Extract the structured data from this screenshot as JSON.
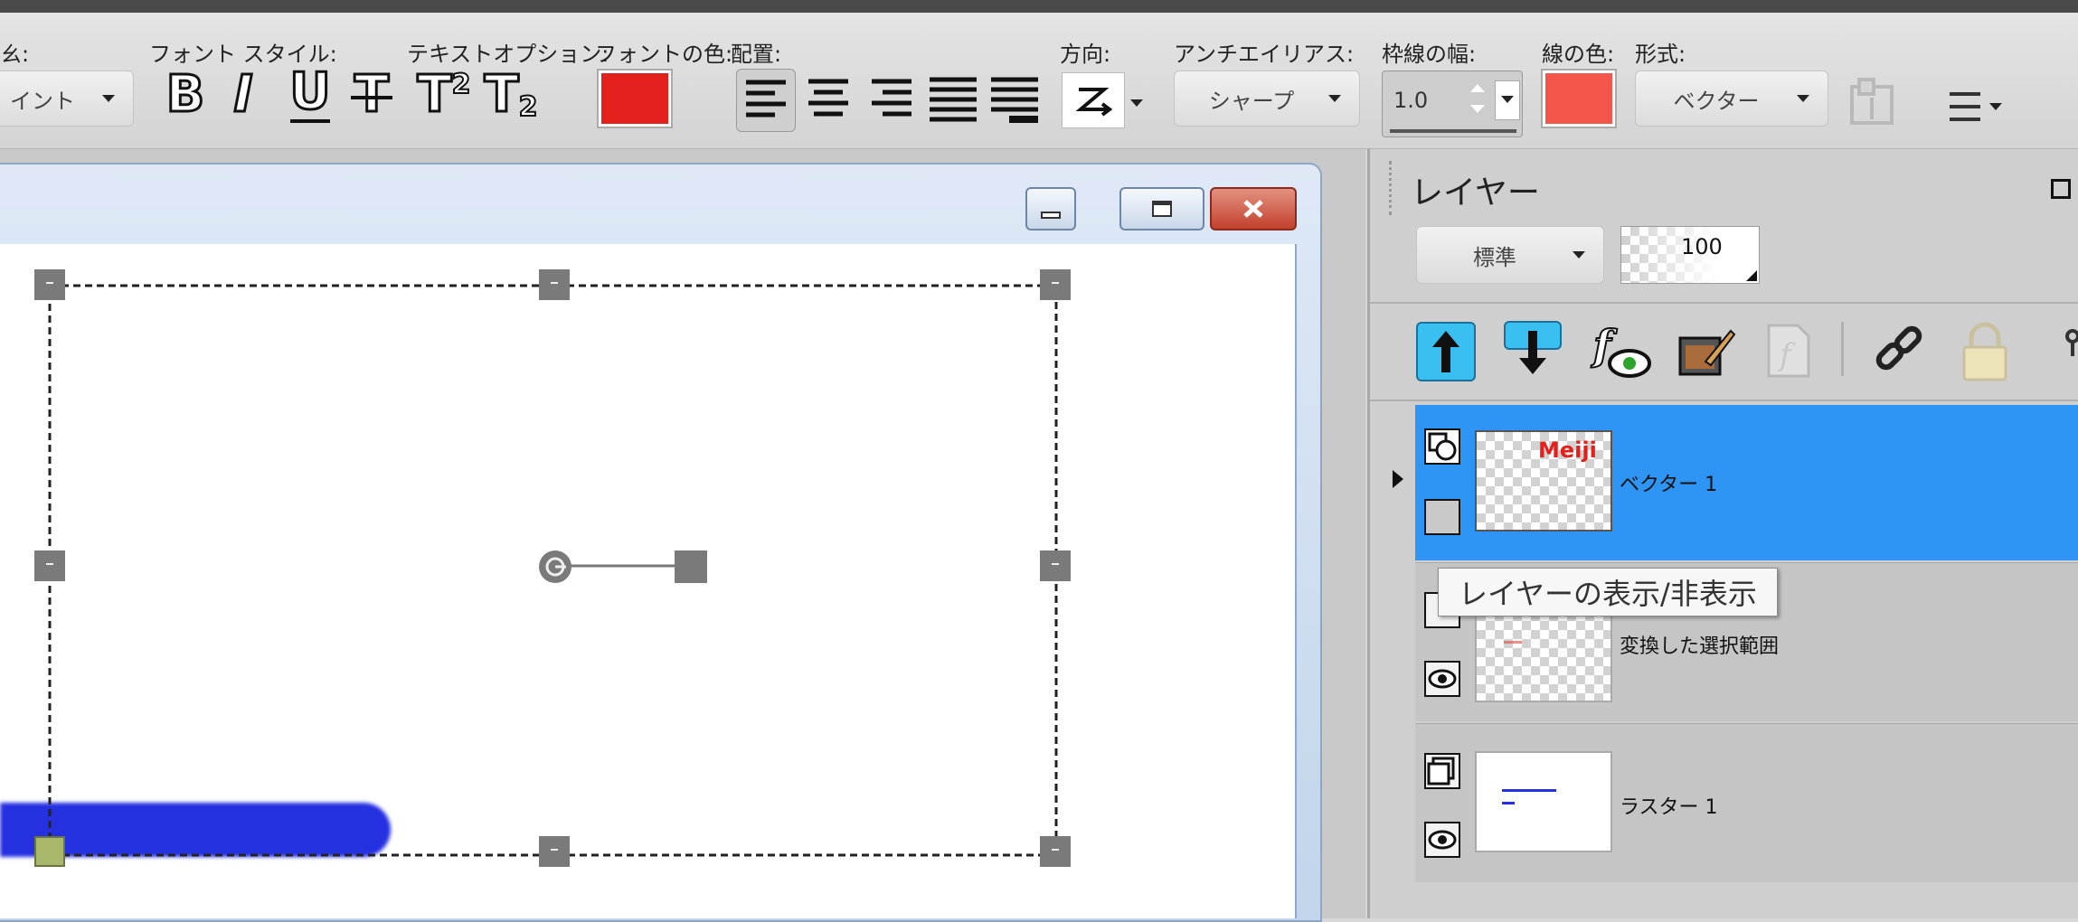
{
  "toolbar": {
    "labels": {
      "size_partial": "ㄠ:",
      "font_style": "フォント スタイル:",
      "text_options": "テキストオプション:",
      "font_color": "フォントの色:",
      "alignment": "配置:",
      "direction": "方向:",
      "antialias": "アンチエイリアス:",
      "stroke_width": "枠線の幅:",
      "line_color": "線の色:",
      "format": "形式:"
    },
    "units_value": "イント",
    "bold": "B",
    "italic": "I",
    "underline": "U",
    "strike": "T",
    "superscript": "T",
    "superscript_mark": "2",
    "subscript": "T",
    "subscript_mark": "2",
    "font_color_hex": "#e3201b",
    "antialias_value": "シャープ",
    "stroke_width_value": "1.0",
    "line_color_hex": "#f4564b",
    "format_value": "ベクター"
  },
  "layers_panel": {
    "title": "レイヤー",
    "blend_mode": "標準",
    "opacity": "100",
    "tooltip": "レイヤーの表示/非表示",
    "layers": [
      {
        "name": "ベクター 1",
        "thumb_text": "Meiji",
        "selected": true
      },
      {
        "name": "変換した選択範囲",
        "selected": false
      },
      {
        "name": "ラスター 1",
        "selected": false
      }
    ]
  },
  "colors": {
    "selection_blue": "#2f95f5",
    "stroke_blue": "#2530e0"
  }
}
